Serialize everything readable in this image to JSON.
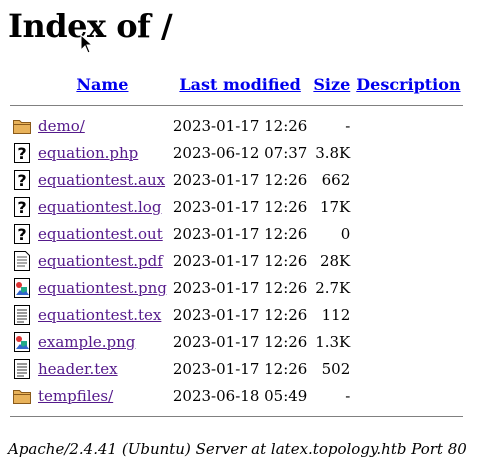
{
  "page": {
    "title": "Index of /"
  },
  "columns": {
    "name": "Name",
    "modified": "Last modified",
    "size": "Size",
    "description": "Description"
  },
  "entries": [
    {
      "name": "demo/",
      "modified": "2023-01-17 12:26",
      "size": "-",
      "icon": "folder-icon"
    },
    {
      "name": "equation.php",
      "modified": "2023-06-12 07:37",
      "size": "3.8K",
      "icon": "unknown-file-icon"
    },
    {
      "name": "equationtest.aux",
      "modified": "2023-01-17 12:26",
      "size": "662",
      "icon": "unknown-file-icon"
    },
    {
      "name": "equationtest.log",
      "modified": "2023-01-17 12:26",
      "size": "17K",
      "icon": "unknown-file-icon"
    },
    {
      "name": "equationtest.out",
      "modified": "2023-01-17 12:26",
      "size": "0",
      "icon": "unknown-file-icon"
    },
    {
      "name": "equationtest.pdf",
      "modified": "2023-01-17 12:26",
      "size": "28K",
      "icon": "document-icon"
    },
    {
      "name": "equationtest.png",
      "modified": "2023-01-17 12:26",
      "size": "2.7K",
      "icon": "image-file-icon"
    },
    {
      "name": "equationtest.tex",
      "modified": "2023-01-17 12:26",
      "size": "112",
      "icon": "text-file-icon"
    },
    {
      "name": "example.png",
      "modified": "2023-01-17 12:26",
      "size": "1.3K",
      "icon": "image-file-icon"
    },
    {
      "name": "header.tex",
      "modified": "2023-01-17 12:26",
      "size": "502",
      "icon": "text-file-icon"
    },
    {
      "name": "tempfiles/",
      "modified": "2023-06-18 05:49",
      "size": "-",
      "icon": "folder-icon"
    }
  ],
  "footer": {
    "address": "Apache/2.4.41 (Ubuntu) Server at latex.topology.htb Port 80"
  }
}
